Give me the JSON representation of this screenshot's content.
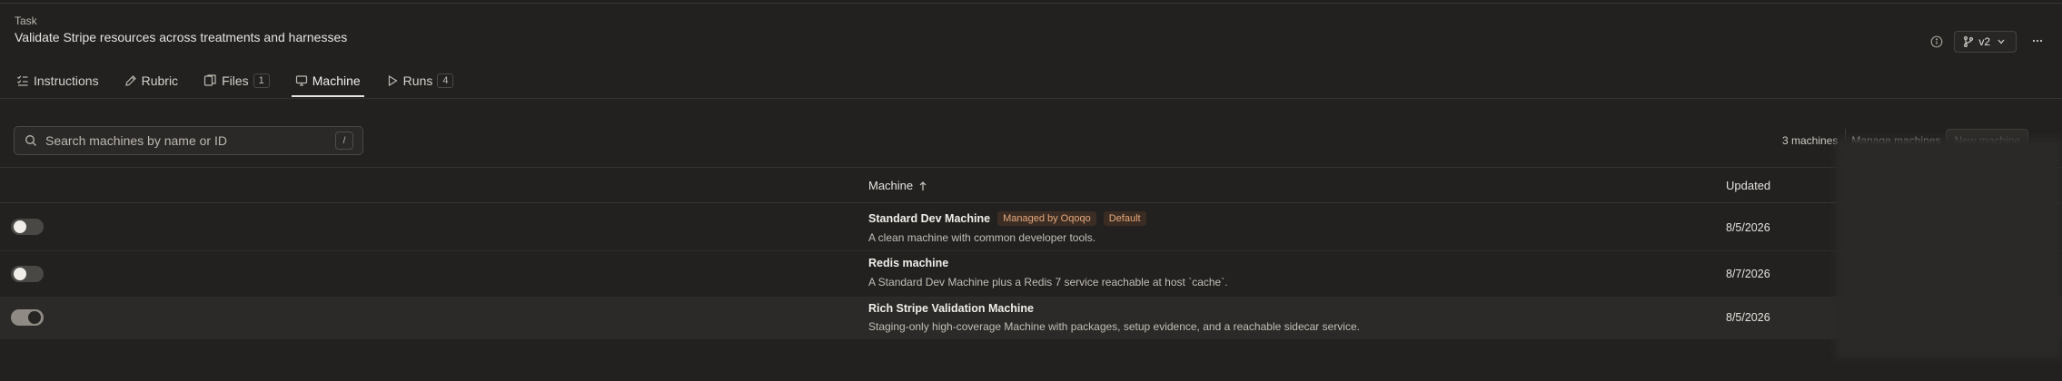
{
  "header": {
    "eyebrow": "Task",
    "title": "Validate Stripe resources across treatments and harnesses",
    "version_label": "v2",
    "info_icon": "info-icon",
    "more_icon": "more-horizontal-icon"
  },
  "tabs": [
    {
      "label": "Instructions",
      "icon": "list-checks-icon",
      "count": null,
      "active": false
    },
    {
      "label": "Rubric",
      "icon": "pencil-icon",
      "count": null,
      "active": false
    },
    {
      "label": "Files",
      "icon": "files-icon",
      "count": "1",
      "active": false
    },
    {
      "label": "Machine",
      "icon": "monitor-icon",
      "count": null,
      "active": true
    },
    {
      "label": "Runs",
      "icon": "play-icon",
      "count": "4",
      "active": false
    }
  ],
  "toolbar": {
    "search_placeholder": "Search machines by name or ID",
    "search_shortcut": "/",
    "machine_count": "3 machines",
    "manage_label": "Manage machines",
    "new_label": "New machine"
  },
  "table": {
    "columns": {
      "machine": "Machine",
      "updated": "Updated"
    },
    "sort": "ascending",
    "rows": [
      {
        "name": "Standard Dev Machine",
        "badges": [
          "Managed by Oqoqo",
          "Default"
        ],
        "description": "A clean machine with common developer tools.",
        "updated": "8/5/2026",
        "enabled": false
      },
      {
        "name": "Redis machine",
        "badges": [],
        "description": "A Standard Dev Machine plus a Redis 7 service reachable at host `cache`.",
        "updated": "8/7/2026",
        "enabled": false
      },
      {
        "name": "Rich Stripe Validation Machine",
        "badges": [],
        "description": "Staging-only high-coverage Machine with packages, setup evidence, and a reachable sidecar service.",
        "updated": "8/5/2026",
        "enabled": true
      }
    ]
  },
  "colors": {
    "background": "#222120",
    "badge_text": "#e6a77a",
    "badge_bg": "#3b2d24"
  }
}
